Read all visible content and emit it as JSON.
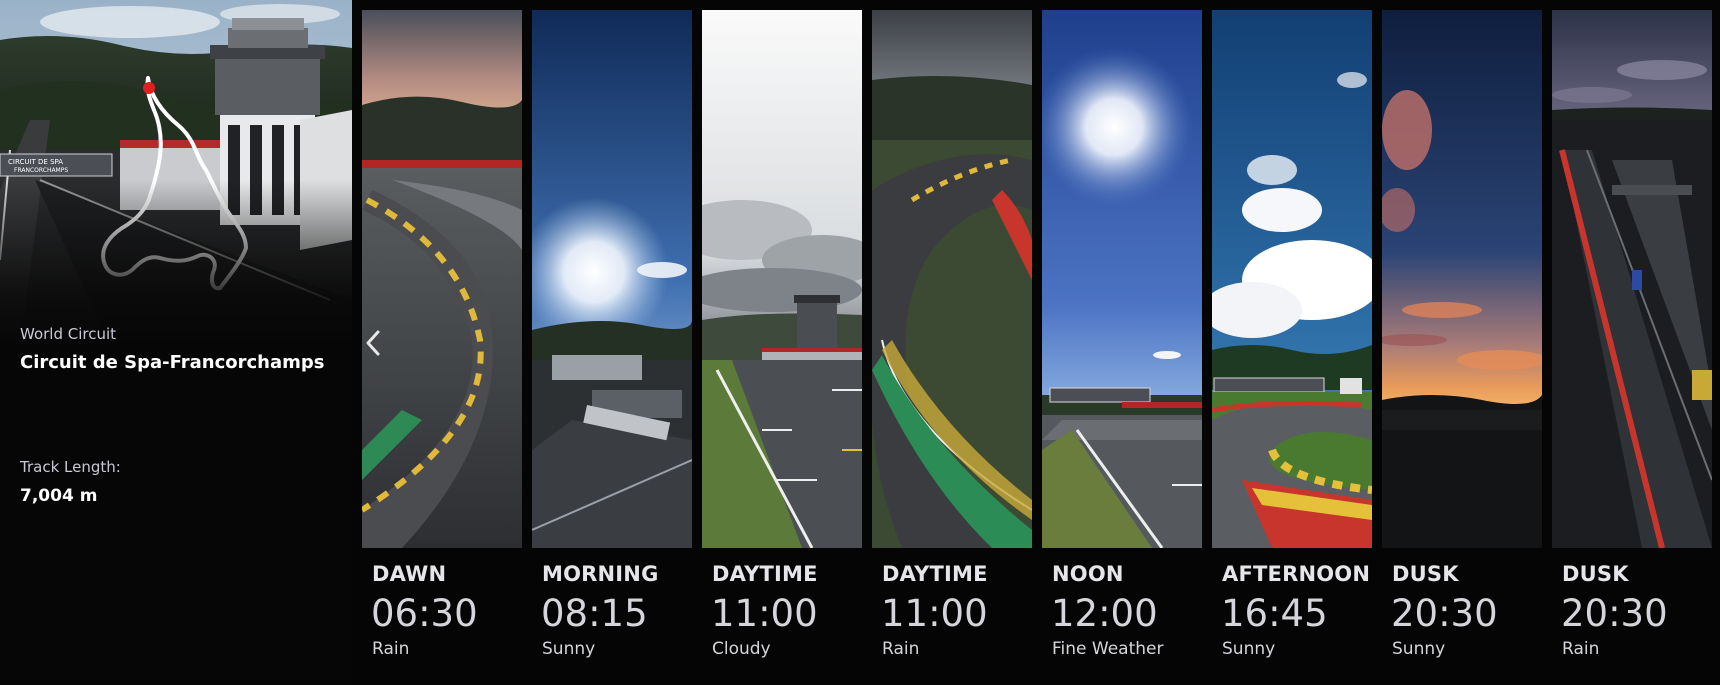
{
  "track": {
    "category": "World Circuit",
    "name": "Circuit de Spa-Francorchamps",
    "length_label": "Track Length:",
    "length_value": "7,004 m",
    "sign_text": "CIRCUIT DE SPA FRANCORCHAMPS"
  },
  "navigation": {
    "prev_icon": "chevron-left-icon"
  },
  "slots": [
    {
      "period": "DAWN",
      "time": "06:30",
      "weather": "Rain"
    },
    {
      "period": "MORNING",
      "time": "08:15",
      "weather": "Sunny"
    },
    {
      "period": "DAYTIME",
      "time": "11:00",
      "weather": "Cloudy"
    },
    {
      "period": "DAYTIME",
      "time": "11:00",
      "weather": "Rain"
    },
    {
      "period": "NOON",
      "time": "12:00",
      "weather": "Fine Weather"
    },
    {
      "period": "AFTERNOON",
      "time": "16:45",
      "weather": "Sunny"
    },
    {
      "period": "DUSK",
      "time": "20:30",
      "weather": "Sunny"
    },
    {
      "period": "DUSK",
      "time": "20:30",
      "weather": "Rain"
    }
  ],
  "colors": {
    "background": "#050505",
    "label_primary": "#e6e6ea",
    "label_secondary": "#d5d5dc",
    "map_marker": "#e02020"
  }
}
